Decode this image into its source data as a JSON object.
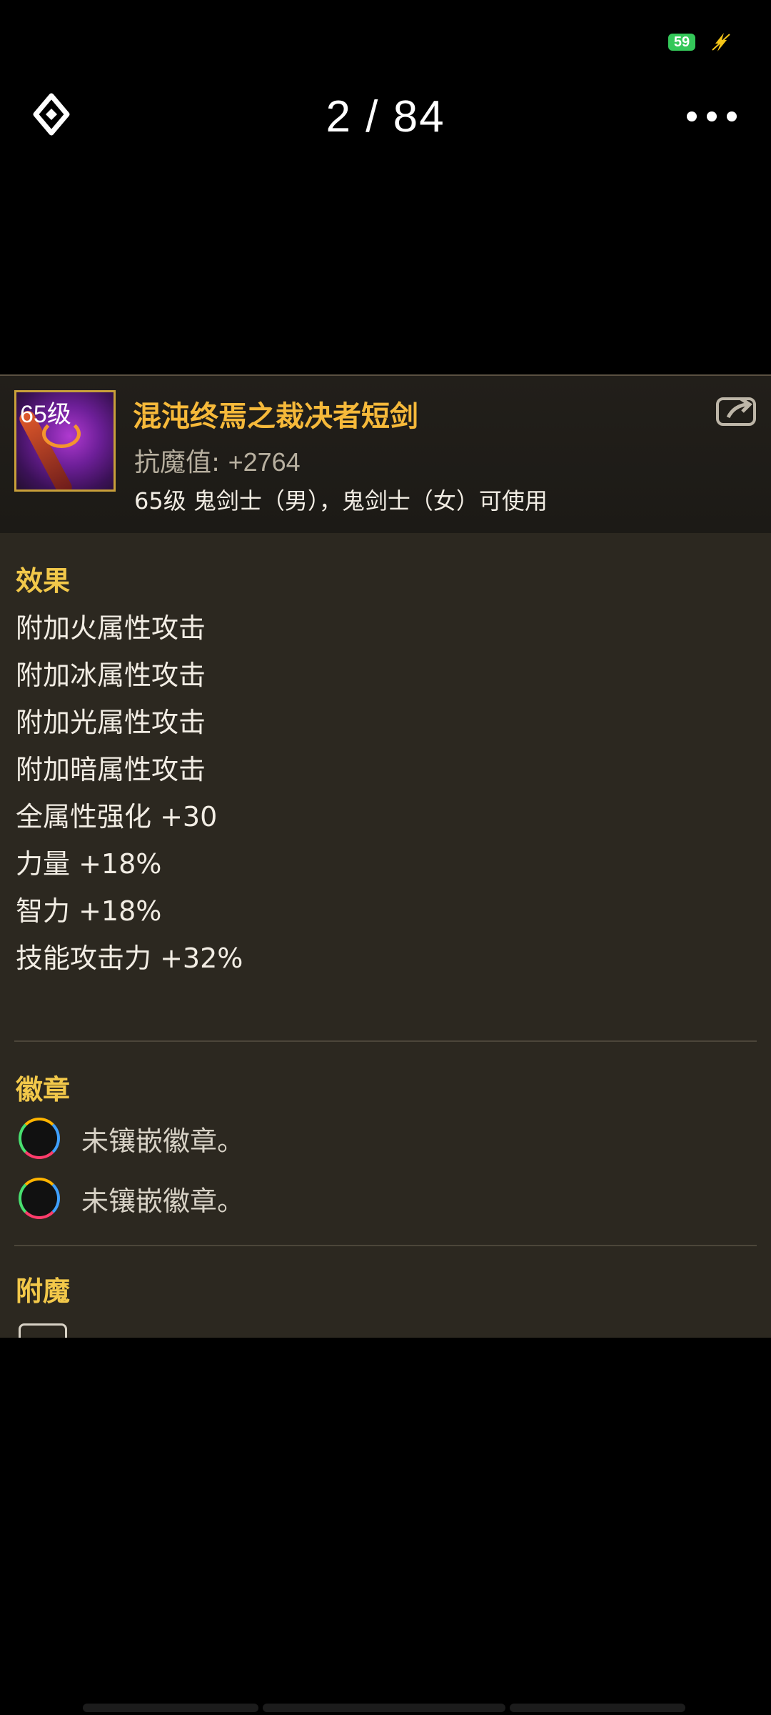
{
  "status": {
    "battery": "59"
  },
  "viewer": {
    "counter": "2  /  84"
  },
  "item": {
    "level_badge": "65级",
    "name": "混沌终焉之裁决者短剑",
    "stat_label": "抗魔值:",
    "stat_value": "+2764",
    "requirement": "65级 鬼剑士（男），鬼剑士（女）可使用"
  },
  "effects": {
    "title": "效果",
    "lines": [
      "附加火属性攻击",
      "附加冰属性攻击",
      "附加光属性攻击",
      "附加暗属性攻击",
      "全属性强化 +30",
      "力量 +18%",
      "智力 +18%",
      "技能攻击力 +32%"
    ]
  },
  "badges": {
    "title": "徽章",
    "slots": [
      "未镶嵌徽章。",
      "未镶嵌徽章。"
    ]
  },
  "enchant": {
    "title": "附魔"
  },
  "colors": {
    "accent_gold": "#f6b93a",
    "section_gold": "#f2c84a",
    "panel_bg": "#2c2820"
  }
}
